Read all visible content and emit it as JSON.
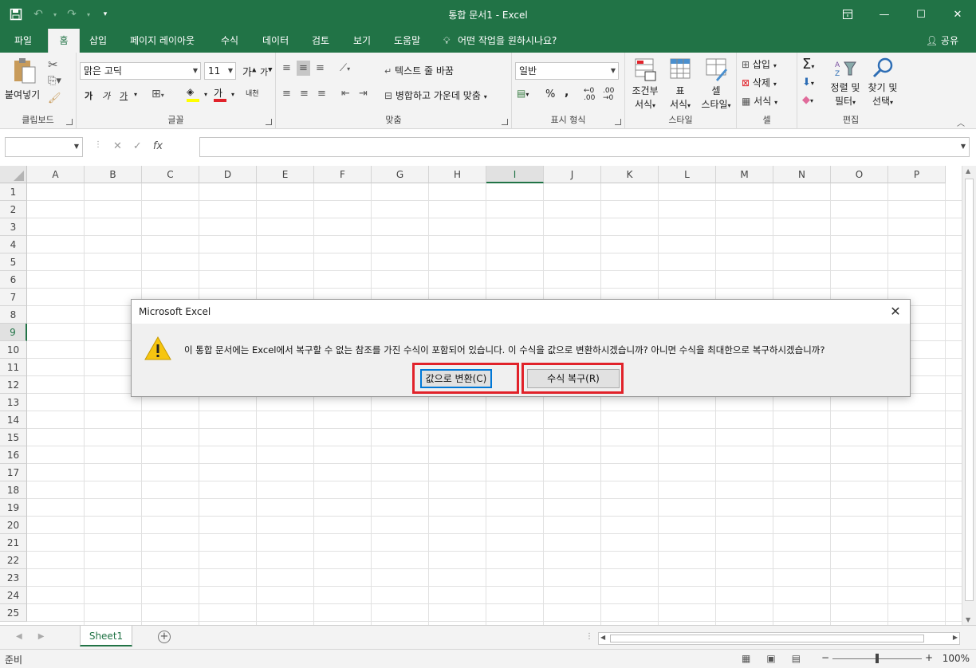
{
  "window": {
    "title": "통합 문서1  -  Excel",
    "controls": [
      "ribbon-display-icon",
      "minimize-icon",
      "maximize-icon",
      "close-icon"
    ]
  },
  "qat": {
    "save": "save-icon",
    "undo": "undo-icon",
    "redo": "redo-icon",
    "customize": "customize-icon"
  },
  "tabs": [
    {
      "label": "파일"
    },
    {
      "label": "홈",
      "active": true
    },
    {
      "label": "삽입"
    },
    {
      "label": "페이지 레이아웃"
    },
    {
      "label": "수식"
    },
    {
      "label": "데이터"
    },
    {
      "label": "검토"
    },
    {
      "label": "보기"
    },
    {
      "label": "도움말"
    },
    {
      "label": "어떤 작업을 원하시나요?"
    }
  ],
  "share_label": "공유",
  "ribbon": {
    "clipboard": {
      "paste": "붙여넣기",
      "label": "클립보드"
    },
    "font": {
      "name": "맑은 고딕",
      "size": "11",
      "grow": "가",
      "shrink": "가",
      "bold": "가",
      "italic": "가",
      "underline": "가",
      "font_color": "가",
      "phonetic": "내천",
      "label": "글꼴"
    },
    "alignment": {
      "wrap": "텍스트 줄 바꿈",
      "merge": "병합하고 가운데 맞춤",
      "label": "맞춤"
    },
    "number": {
      "format": "일반",
      "percent": "%",
      "comma": ",",
      "label": "표시 형식"
    },
    "styles": {
      "conditional": [
        "조건부",
        "서식"
      ],
      "table": [
        "표",
        "서식"
      ],
      "cell": [
        "셀",
        "스타일"
      ],
      "label": "스타일"
    },
    "cells": {
      "insert": "삽입",
      "delete": "삭제",
      "format": "서식",
      "label": "셀"
    },
    "editing": {
      "sort": [
        "정렬 및",
        "필터"
      ],
      "find": [
        "찾기 및",
        "선택"
      ],
      "label": "편집"
    }
  },
  "formula_bar": {
    "name_box": "",
    "formula": "",
    "fx": "fx"
  },
  "columns": [
    "A",
    "B",
    "C",
    "D",
    "E",
    "F",
    "G",
    "H",
    "I",
    "J",
    "K",
    "L",
    "M",
    "N",
    "O",
    "P"
  ],
  "selected_column": "I",
  "rows": [
    "1",
    "2",
    "3",
    "4",
    "5",
    "6",
    "7",
    "8",
    "9",
    "10",
    "11",
    "12",
    "13",
    "14",
    "15",
    "16",
    "17",
    "18",
    "19",
    "20",
    "21",
    "22",
    "23",
    "24",
    "25"
  ],
  "selected_row": "9",
  "sheet_tabs": [
    {
      "label": "Sheet1",
      "active": true
    }
  ],
  "status": {
    "ready": "준비",
    "zoom": "100%"
  },
  "dialog": {
    "title": "Microsoft Excel",
    "message": "이 통합 문서에는 Excel에서 복구할 수 없는 참조를 가진 수식이 포함되어 있습니다. 이 수식을 값으로 변환하시겠습니까? 아니면 수식을 최대한으로 복구하시겠습니까?",
    "convert_button": "값으로 변환(C)",
    "recover_button": "수식 복구(R)",
    "highlight_color": "#e1222a"
  }
}
